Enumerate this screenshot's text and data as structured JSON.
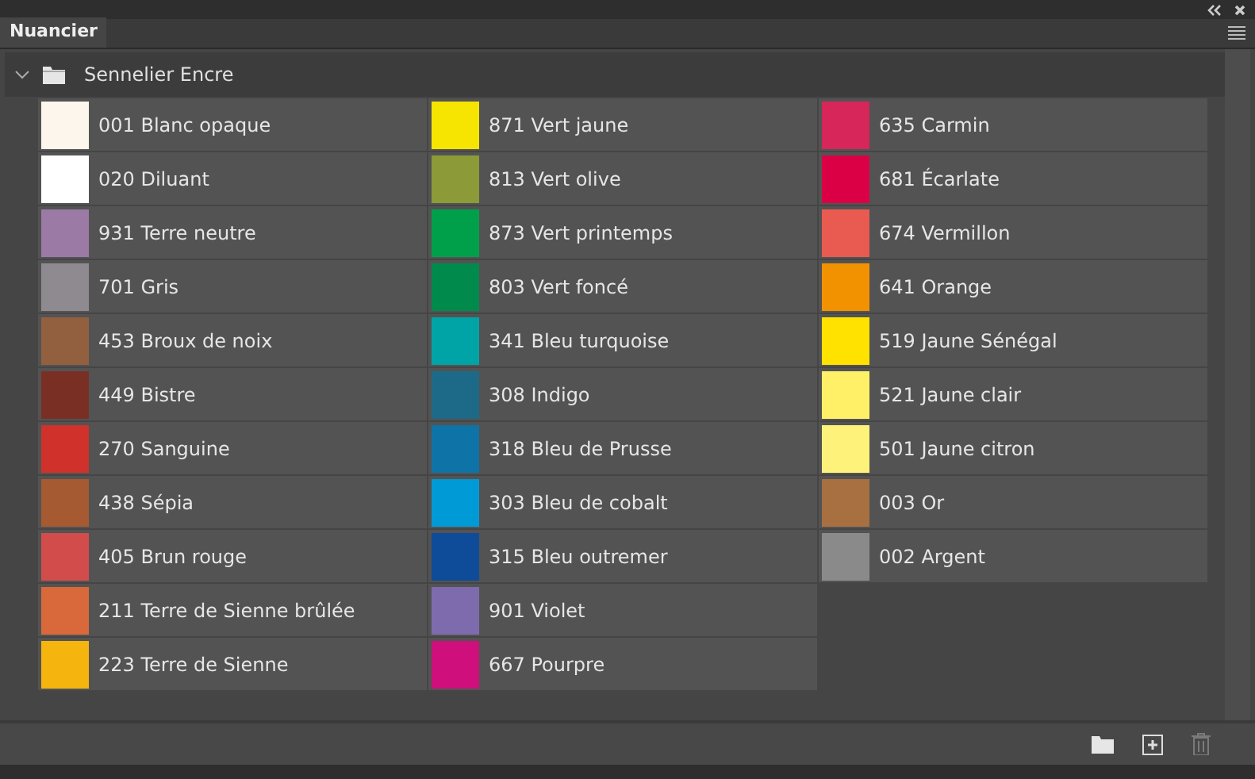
{
  "panel": {
    "tab": {
      "label": "Nuancier",
      "selected": true
    }
  },
  "group": {
    "name": "Sennelier Encre",
    "expanded": true
  },
  "swatches": [
    {
      "name": "001 Blanc opaque",
      "color": "#fdf6ec"
    },
    {
      "name": "020 Diluant",
      "color": "#ffffff"
    },
    {
      "name": "931 Terre neutre",
      "color": "#9b7aa6"
    },
    {
      "name": "701 Gris",
      "color": "#8e8a8f"
    },
    {
      "name": "453 Broux de noix",
      "color": "#93603f"
    },
    {
      "name": "449 Bistre",
      "color": "#7a2f24"
    },
    {
      "name": "270 Sanguine",
      "color": "#d0312a"
    },
    {
      "name": "438 Sépia",
      "color": "#a65a32"
    },
    {
      "name": "405 Brun rouge",
      "color": "#d34c4c"
    },
    {
      "name": "211 Terre de Sienne brûlée",
      "color": "#d9693a"
    },
    {
      "name": "223 Terre de Sienne",
      "color": "#f6b40e"
    },
    {
      "name": "871 Vert jaune",
      "color": "#f6e500"
    },
    {
      "name": "813 Vert olive",
      "color": "#8c9b37"
    },
    {
      "name": "873 Vert printemps",
      "color": "#00a04b"
    },
    {
      "name": "803 Vert foncé",
      "color": "#008a4c"
    },
    {
      "name": "341 Bleu turquoise",
      "color": "#00a4a6"
    },
    {
      "name": "308 Indigo",
      "color": "#1d6a88"
    },
    {
      "name": "318 Bleu de Prusse",
      "color": "#0e74a7"
    },
    {
      "name": "303 Bleu de cobalt",
      "color": "#009bd7"
    },
    {
      "name": "315 Bleu outremer",
      "color": "#0e4c9a"
    },
    {
      "name": "901 Violet",
      "color": "#7e6bae"
    },
    {
      "name": "667 Pourpre",
      "color": "#cf0f7b"
    },
    {
      "name": "635 Carmin",
      "color": "#d6265a"
    },
    {
      "name": "681 Écarlate",
      "color": "#db0045"
    },
    {
      "name": "674 Vermillon",
      "color": "#e95b50"
    },
    {
      "name": "641 Orange",
      "color": "#f39200"
    },
    {
      "name": "519 Jaune Sénégal",
      "color": "#ffe200"
    },
    {
      "name": "521 Jaune clair",
      "color": "#fff067"
    },
    {
      "name": "501 Jaune citron",
      "color": "#fff27a"
    },
    {
      "name": "003 Or",
      "color": "#a87040"
    },
    {
      "name": "002 Argent",
      "color": "#8a8a8a"
    }
  ]
}
